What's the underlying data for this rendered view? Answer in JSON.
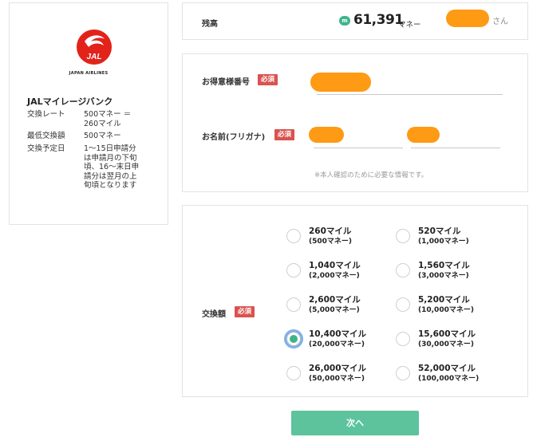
{
  "left_card": {
    "logo_text": "JAL",
    "logo_subtitle": "JAPAN AIRLINES",
    "title": "JALマイレージバンク",
    "rows": [
      {
        "key": "交換レート",
        "value": "500マネー ＝ 260マイル"
      },
      {
        "key": "最低交換額",
        "value": "500マネー"
      },
      {
        "key": "交換予定日",
        "value": "1〜15日申請分は申請月の下旬頃、16〜末日申請分は翌月の上旬頃となります"
      }
    ]
  },
  "balance": {
    "label": "残高",
    "icon_text": "m",
    "icon": "money-coin-icon",
    "value": "61,391",
    "unit": "マネー",
    "user_suffix": "さん"
  },
  "customer": {
    "account_label": "お得意様番号",
    "name_label": "お名前(フリガナ)",
    "required_label": "必須",
    "note": "※本人確認のために必要な情報です。"
  },
  "exchange": {
    "label": "交換額",
    "required_label": "必須",
    "selected_index": 6,
    "options": [
      {
        "miles": "260マイル",
        "money": "(500マネー)"
      },
      {
        "miles": "520マイル",
        "money": "(1,000マネー)"
      },
      {
        "miles": "1,040マイル",
        "money": "(2,000マネー)"
      },
      {
        "miles": "1,560マイル",
        "money": "(3,000マネー)"
      },
      {
        "miles": "2,600マイル",
        "money": "(5,000マネー)"
      },
      {
        "miles": "5,200マイル",
        "money": "(10,000マネー)"
      },
      {
        "miles": "10,400マイル",
        "money": "(20,000マネー)"
      },
      {
        "miles": "15,600マイル",
        "money": "(30,000マネー)"
      },
      {
        "miles": "26,000マイル",
        "money": "(50,000マネー)"
      },
      {
        "miles": "52,000マイル",
        "money": "(100,000マネー)"
      }
    ]
  },
  "next_button": {
    "label": "次へ"
  },
  "colors": {
    "accent_green": "#5cc39d",
    "required_red": "#d9534f",
    "redaction_orange": "#fe9a14",
    "jal_red": "#e2231a"
  }
}
